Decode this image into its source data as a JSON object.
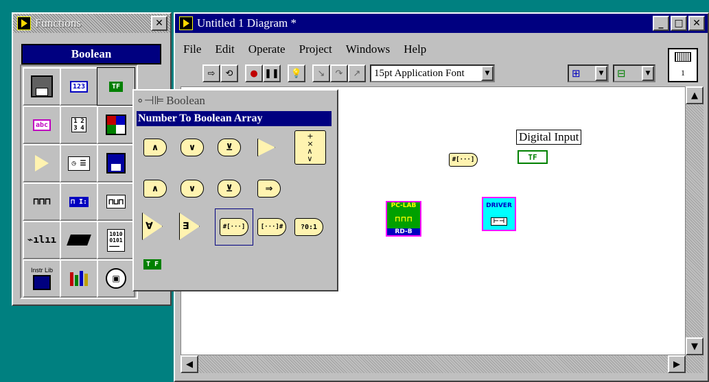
{
  "functions_palette": {
    "title": "Functions",
    "category_label": "Boolean",
    "cells": [
      {
        "icon": "cluster-icon"
      },
      {
        "icon": "numeric-icon",
        "text": "123"
      },
      {
        "icon": "boolean-icon",
        "text": "TF"
      },
      {
        "icon": "string-icon",
        "text": "abc"
      },
      {
        "icon": "array-icon"
      },
      {
        "icon": "cluster-icon-2"
      },
      {
        "icon": "comparison-icon"
      },
      {
        "icon": "time-dialog-icon"
      },
      {
        "icon": "file-io-icon"
      },
      {
        "icon": "data-acquisition-icon"
      },
      {
        "icon": "analysis-icon"
      },
      {
        "icon": "waveform-icon"
      },
      {
        "icon": "math-icon"
      },
      {
        "icon": "tutorial-icon"
      },
      {
        "icon": "advanced-icon"
      },
      {
        "icon": "instrument-library-icon",
        "text": "Instr Lib"
      },
      {
        "icon": "user-library-icon"
      },
      {
        "icon": "select-vi-icon"
      }
    ]
  },
  "boolean_subpalette": {
    "title": "Boolean",
    "tooltip": "Number To Boolean Array",
    "rows": [
      [
        "and-gate",
        "or-gate",
        "xor-gate",
        "not-gate",
        "compound-arithmetic"
      ],
      [
        "nand-gate",
        "nor-gate",
        "xnor-gate",
        "implies-gate"
      ],
      [
        "and-array-elements",
        "or-array-elements",
        "number-to-boolean-array",
        "boolean-array-to-number",
        "boolean-to-0-1"
      ],
      [
        "boolean-constant"
      ]
    ],
    "labels": {
      "and": "∧",
      "or": "∨",
      "xor": "⊻",
      "not": "¬",
      "implies": "⇒",
      "num_to_bool": "#[···]",
      "bool_to_num": "[···]#",
      "bool_to_01": "?0:1",
      "true_false": "T F"
    }
  },
  "diagram_window": {
    "title": "Untitled 1 Diagram *",
    "menu": [
      "File",
      "Edit",
      "Operate",
      "Project",
      "Windows",
      "Help"
    ],
    "font_dropdown": "15pt Application Font",
    "canvas": {
      "label_digital_input": "Digital Input",
      "tf_terminal": "TF",
      "num_to_bool_node": "#[···]",
      "pc_lab_top": "PC-LAB",
      "pc_lab_bottom": "RD-B",
      "driver_label": "DRIVER"
    },
    "connector_pane_number": "1"
  },
  "colors": {
    "desktop": "#008080",
    "titlebar_active": "#000080",
    "window_face": "#c0c0c0",
    "boolean_green": "#008000",
    "subvi_magenta": "#ff00ff",
    "subvi_cyan": "#00ffff"
  }
}
